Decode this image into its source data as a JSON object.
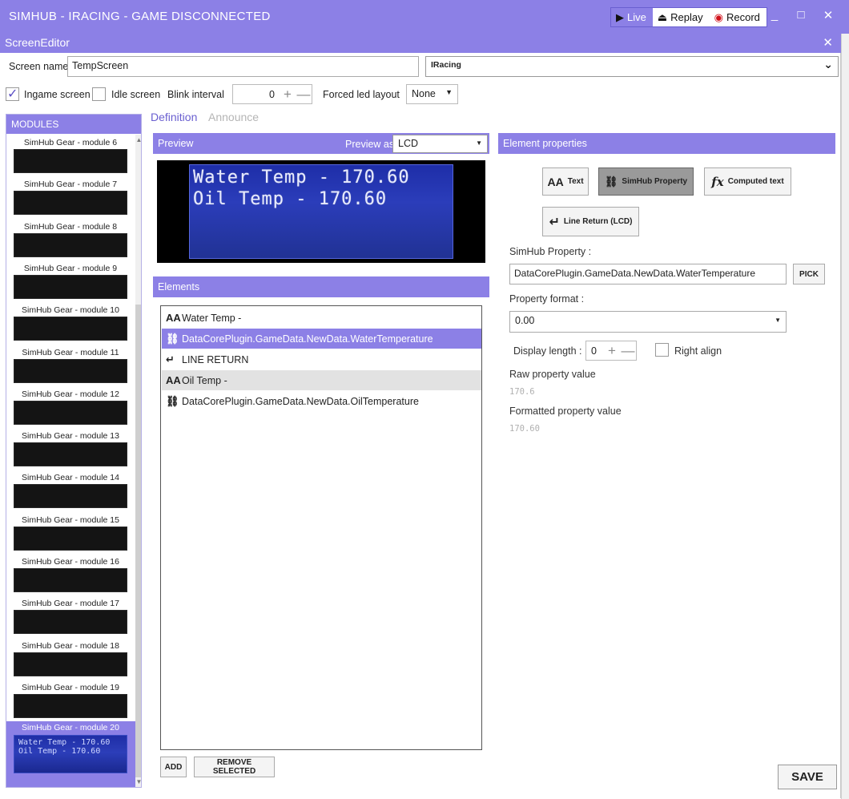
{
  "app": {
    "title": "SIMHUB - IRACING - GAME DISCONNECTED",
    "modes": [
      {
        "label": "Live",
        "icon": "play-icon",
        "active": true
      },
      {
        "label": "Replay",
        "icon": "replay-icon",
        "active": false
      },
      {
        "label": "Record",
        "icon": "record-icon",
        "active": false
      }
    ],
    "window_controls": {
      "minimize": "_",
      "maximize": "□",
      "close": "✕"
    },
    "accent_color": "#8c80e6"
  },
  "editor": {
    "title": "ScreenEditor",
    "close": "✕",
    "screen_name_label": "Screen name",
    "screen_name_value": "TempScreen",
    "game_select": "IRacing",
    "ingame_label": "Ingame screen",
    "ingame_checked": true,
    "idle_label": "Idle screen",
    "idle_checked": false,
    "blink_label": "Blink interval",
    "blink_value": "0",
    "forced_led_label": "Forced led layout",
    "forced_led_value": "None"
  },
  "modules": {
    "header": "MODULES",
    "items": [
      "SimHub Gear - module 6",
      "SimHub Gear - module 7",
      "SimHub Gear - module 8",
      "SimHub Gear - module 9",
      "SimHub Gear - module 10",
      "SimHub Gear - module 11",
      "SimHub Gear - module 12",
      "SimHub Gear - module 13",
      "SimHub Gear - module 14",
      "SimHub Gear - module 15",
      "SimHub Gear - module 16",
      "SimHub Gear - module 17",
      "SimHub Gear - module 18",
      "SimHub Gear - module 19"
    ],
    "selected": {
      "label": "SimHub Gear - module 20",
      "preview": "Water Temp - 170.60\nOil Temp - 170.60"
    }
  },
  "tabs": {
    "definition": "Definition",
    "announce": "Announce"
  },
  "preview": {
    "header": "Preview",
    "preview_as_label": "Preview as",
    "preview_as_value": "LCD",
    "lcd_text": "Water Temp - 170.60\nOil Temp - 170.60"
  },
  "elements": {
    "header": "Elements",
    "rows": [
      {
        "icon": "text-icon",
        "glyph": "AA",
        "label": "Water Temp -"
      },
      {
        "icon": "link-icon",
        "glyph": "⛓",
        "label": "DataCorePlugin.GameData.NewData.WaterTemperature"
      },
      {
        "icon": "line-return-icon",
        "glyph": "↵",
        "label": "LINE RETURN"
      },
      {
        "icon": "text-icon",
        "glyph": "AA",
        "label": "Oil Temp -"
      },
      {
        "icon": "link-icon",
        "glyph": "⛓",
        "label": "DataCorePlugin.GameData.NewData.OilTemperature"
      }
    ],
    "add_button": "ADD",
    "remove_button": "REMOVE SELECTED"
  },
  "properties": {
    "header": "Element properties",
    "type_buttons": {
      "text": "Text",
      "simhub_property": "SimHub Property",
      "computed_text": "Computed text",
      "line_return": "Line Return (LCD)"
    },
    "simhub_property_label": "SimHub Property :",
    "simhub_property_value": "DataCorePlugin.GameData.NewData.WaterTemperature",
    "pick_button": "PICK",
    "property_format_label": "Property format :",
    "property_format_value": "0.00",
    "display_length_label": "Display length :",
    "display_length_value": "0",
    "right_align_label": "Right align",
    "raw_label": "Raw property value",
    "raw_value": "170.6",
    "formatted_label": "Formatted property value",
    "formatted_value": "170.60"
  },
  "save_button": "SAVE"
}
